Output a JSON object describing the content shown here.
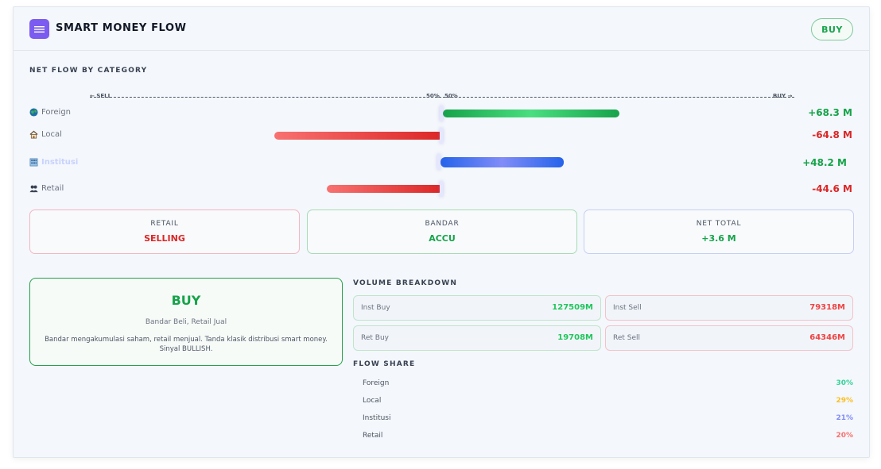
{
  "header": {
    "title": "SMART MONEY FLOW",
    "icon": "menu-lines-icon",
    "signal_label": "BUY"
  },
  "net_flow": {
    "section_label": "NET FLOW BY CATEGORY",
    "axis": {
      "left_label": "← SELL",
      "center_left": "50%",
      "center_right": "50%",
      "right_label": "BUY →"
    },
    "rows": [
      {
        "label": "Foreign",
        "icon": "globe-icon",
        "value": "+68.3 M",
        "amount": 68.3,
        "color": "#16a34a"
      },
      {
        "label": "Local",
        "icon": "house-icon",
        "value": "-64.8 M",
        "amount": -64.8,
        "color": "#dc2626"
      },
      {
        "label": "Institusi",
        "icon": "building-icon",
        "value": "+48.2 M",
        "amount": 48.2,
        "color": "#16a34a"
      },
      {
        "label": "Retail",
        "icon": "people-icon",
        "value": "-44.6 M",
        "amount": -44.6,
        "color": "#dc2626"
      }
    ]
  },
  "summary": {
    "retail": {
      "label": "RETAIL",
      "value": "SELLING",
      "color": "#dc2626"
    },
    "bandar": {
      "label": "BANDAR",
      "value": "ACCU",
      "color": "#16a34a"
    },
    "net_total": {
      "label": "NET TOTAL",
      "value": "+3.6 M",
      "color": "#16a34a"
    }
  },
  "signal": {
    "value": "BUY",
    "subtitle": "Bandar Beli, Retail Jual",
    "description": "Bandar mengakumulasi saham, retail menjual. Tanda klasik distribusi smart money. Sinyal BULLISH."
  },
  "volume": {
    "section_label": "VOLUME BREAKDOWN",
    "items": [
      {
        "label": "Inst Buy",
        "value": "127509M",
        "color": "#22c55e"
      },
      {
        "label": "Inst Sell",
        "value": "79318M",
        "color": "#ef4444"
      },
      {
        "label": "Ret Buy",
        "value": "19708M",
        "color": "#22c55e"
      },
      {
        "label": "Ret Sell",
        "value": "64346M",
        "color": "#ef4444"
      }
    ]
  },
  "flow_share": {
    "section_label": "FLOW SHARE",
    "items": [
      {
        "label": "Foreign",
        "value": "30%",
        "color": "#34d399"
      },
      {
        "label": "Local",
        "value": "29%",
        "color": "#fbbf24"
      },
      {
        "label": "Institusi",
        "value": "21%",
        "color": "#818cf8"
      },
      {
        "label": "Retail",
        "value": "20%",
        "color": "#f87171"
      }
    ]
  }
}
